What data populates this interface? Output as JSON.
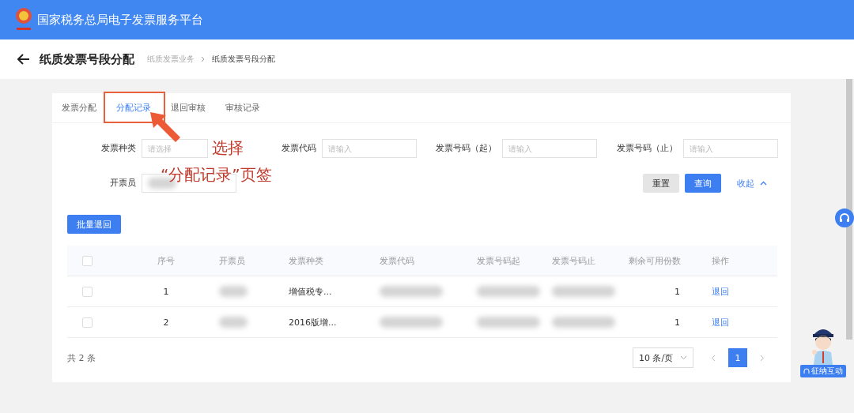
{
  "header": {
    "title": "国家税务总局电子发票服务平台"
  },
  "page": {
    "title": "纸质发票号段分配",
    "breadcrumb": [
      "纸质发票业务",
      "纸质发票号段分配"
    ]
  },
  "tabs": [
    {
      "label": "发票分配",
      "selected": false
    },
    {
      "label": "分配记录",
      "selected": true
    },
    {
      "label": "退回审核",
      "selected": false
    },
    {
      "label": "审核记录",
      "selected": false
    }
  ],
  "filters": [
    {
      "label": "发票种类",
      "kind": "select",
      "placeholder": "请选择"
    },
    {
      "label": "发票代码",
      "kind": "input",
      "placeholder": "请输入"
    },
    {
      "label": "发票号码（起）",
      "kind": "input",
      "placeholder": "请输入"
    },
    {
      "label": "发票号码（止）",
      "kind": "input",
      "placeholder": "请输入"
    },
    {
      "label": "开票员",
      "kind": "redacted"
    }
  ],
  "filter_actions": {
    "reset": "重置",
    "search": "查询",
    "collapse": "收起"
  },
  "annotation": {
    "line1": "选择",
    "line2": "“分配记录”页签"
  },
  "batch_button": "批量退回",
  "table": {
    "columns": [
      "序号",
      "开票员",
      "发票种类",
      "发票代码",
      "发票号码起",
      "发票号码止",
      "剩余可用份数",
      "操作"
    ],
    "header_checked": false,
    "rows": [
      {
        "checked": false,
        "index": "1",
        "type": "增值税专...",
        "remaining": "1",
        "action": "退回"
      },
      {
        "checked": false,
        "index": "2",
        "type": "2016版增...",
        "remaining": "1",
        "action": "退回"
      }
    ]
  },
  "footer": {
    "total": "共 2 条",
    "page_size": "10 条/页",
    "pages": [
      {
        "label": "1",
        "selected": true
      }
    ]
  },
  "service_badge": "征纳互动"
}
